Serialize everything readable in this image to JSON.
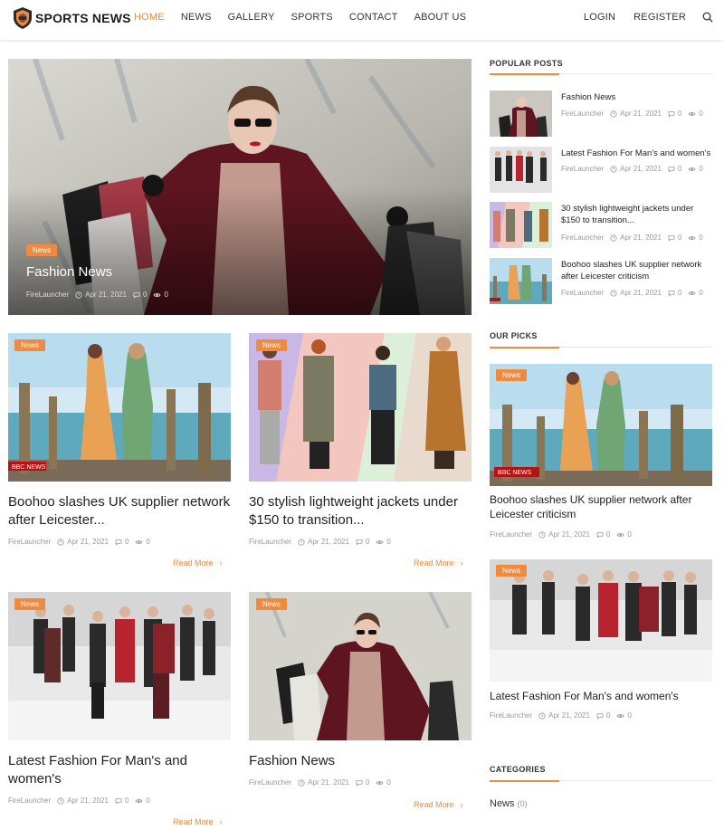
{
  "header": {
    "logo_text": "SPORTS NEWS",
    "nav": [
      "HOME",
      "NEWS",
      "GALLERY",
      "SPORTS",
      "CONTACT",
      "ABOUT US"
    ],
    "active_nav": "HOME",
    "login": "LOGIN",
    "register": "REGISTER",
    "accent_color": "#f08a3e"
  },
  "featured": {
    "badge": "News",
    "title": "Fashion News",
    "author": "FireLauncher",
    "date": "Apr 21, 2021",
    "comments": "0",
    "views": "0"
  },
  "grid": [
    {
      "badge": "News",
      "title": "Boohoo slashes UK supplier network after Leicester...",
      "author": "FireLauncher",
      "date": "Apr 21, 2021",
      "comments": "0",
      "views": "0",
      "read_more": "Read More",
      "image_caption": "BBC NEWS"
    },
    {
      "badge": "News",
      "title": "30 stylish lightweight jackets under $150 to transition...",
      "author": "FireLauncher",
      "date": "Apr 21, 2021",
      "comments": "0",
      "views": "0",
      "read_more": "Read More"
    },
    {
      "badge": "News",
      "title": "Latest Fashion For Man's and women's",
      "author": "FireLauncher",
      "date": "Apr 21, 2021",
      "comments": "0",
      "views": "0",
      "read_more": "Read More"
    },
    {
      "badge": "News",
      "title": "Fashion News",
      "author": "FireLauncher",
      "date": "Apr 21, 2021",
      "comments": "0",
      "views": "0",
      "read_more": "Read More"
    }
  ],
  "sidebar": {
    "popular_heading": "POPULAR POSTS",
    "popular": [
      {
        "title": "Fashion News",
        "author": "FireLauncher",
        "date": "Apr 21, 2021",
        "comments": "0",
        "views": "0"
      },
      {
        "title": "Latest Fashion For Man's and women's",
        "author": "FireLauncher",
        "date": "Apr 21, 2021",
        "comments": "0",
        "views": "0"
      },
      {
        "title": "30 stylish lightweight jackets under $150 to transition...",
        "author": "FireLauncher",
        "date": "Apr 21, 2021",
        "comments": "0",
        "views": "0"
      },
      {
        "title": "Boohoo slashes UK supplier network after Leicester criticism",
        "author": "FireLauncher",
        "date": "Apr 21, 2021",
        "comments": "0",
        "views": "0"
      }
    ],
    "picks_heading": "OUR PICKS",
    "picks": [
      {
        "badge": "News",
        "title": "Boohoo slashes UK supplier network after Leicester criticism",
        "author": "FireLauncher",
        "date": "Apr 21, 2021",
        "comments": "0",
        "views": "0",
        "image_caption": "BBC NEWS"
      },
      {
        "badge": "News",
        "title": "Latest Fashion For Man's and women's",
        "author": "FireLauncher",
        "date": "Apr 21, 2021",
        "comments": "0",
        "views": "0"
      }
    ],
    "categories_heading": "CATEGORIES",
    "categories": [
      {
        "name": "News",
        "count": "(0)"
      }
    ]
  }
}
